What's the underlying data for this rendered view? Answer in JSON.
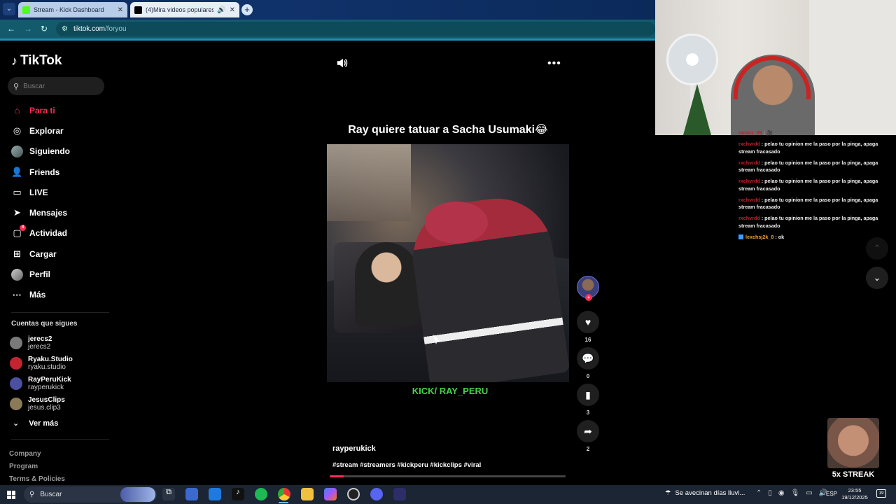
{
  "browser": {
    "tabs": [
      {
        "title": "Stream - Kick Dashboard",
        "favicon_color": "#53fc18",
        "active": false
      },
      {
        "title": "(4)Mira videos populares s",
        "favicon_color": "#000000",
        "active": true
      }
    ],
    "url_host": "tiktok.com",
    "url_path": "/foryou"
  },
  "tiktok": {
    "logo_text": "TikTok",
    "search_placeholder": "Buscar",
    "nav": [
      {
        "label": "Para ti",
        "icon": "home-icon",
        "active": true
      },
      {
        "label": "Explorar",
        "icon": "compass-icon"
      },
      {
        "label": "Siguiendo",
        "icon": "following-avatar-icon"
      },
      {
        "label": "Friends",
        "icon": "friends-icon"
      },
      {
        "label": "LIVE",
        "icon": "live-icon"
      },
      {
        "label": "Mensajes",
        "icon": "messages-icon"
      },
      {
        "label": "Actividad",
        "icon": "activity-icon",
        "badge": "4"
      },
      {
        "label": "Cargar",
        "icon": "upload-icon"
      },
      {
        "label": "Perfil",
        "icon": "profile-avatar-icon"
      },
      {
        "label": "Más",
        "icon": "more-icon"
      }
    ],
    "following_header": "Cuentas que sigues",
    "following": [
      {
        "name": "jerecs2",
        "handle": "jerecs2",
        "color": "#7a7a7a"
      },
      {
        "name": "Ryaku.Studio",
        "handle": "ryaku.studio",
        "color": "#c4242f"
      },
      {
        "name": "RayPeruKick",
        "handle": "rayperukick",
        "color": "#4b50a0"
      },
      {
        "name": "JesusClips",
        "handle": "jesus.clip3",
        "color": "#8a7a55"
      }
    ],
    "see_more": "Ver más",
    "footer_links": [
      "Company",
      "Program",
      "Terms & Policies"
    ],
    "video": {
      "title": "Ray quiere tatuar a Sacha Usumaki😂",
      "overlay_caption": "KICK/ RAY_PERU",
      "likes": "16",
      "comments": "0",
      "saves": "3",
      "shares": "2",
      "author": "rayperukick",
      "hashtags": "#stream #streamers #kickperu #kickclips #viral",
      "progress": 0.06
    }
  },
  "stream_overlay": {
    "chat": [
      {
        "user": "ramirz_09",
        "msg": "🎥",
        "color": "#c0202e"
      },
      {
        "user": "rxchvrdd",
        "msg": "pelao tu opinion me la paso por la pinga, apaga stream fracasado",
        "color": "#c0202e"
      },
      {
        "user": "rxchvrdd",
        "msg": "pelao tu opinion me la paso por la pinga, apaga stream fracasado",
        "color": "#c0202e"
      },
      {
        "user": "rxchvrdd",
        "msg": "pelao tu opinion me la paso por la pinga, apaga stream fracasado",
        "color": "#c0202e"
      },
      {
        "user": "rxchvrdd",
        "msg": "pelao tu opinion me la paso por la pinga, apaga stream fracasado",
        "color": "#c0202e"
      },
      {
        "user": "rxchvrdd",
        "msg": "pelao tu opinion me la paso por la pinga, apaga stream fracasado",
        "color": "#c0202e"
      },
      {
        "user": "lexchsj2k_8",
        "msg": "ok",
        "color": "#e8a640",
        "icon": true
      }
    ],
    "streak_text": "5x STREAK"
  },
  "taskbar": {
    "search_placeholder": "Buscar",
    "weather_text": "Se avecinan días lluvi...",
    "language": "ESP",
    "time": "23:55",
    "date": "19/12/2025",
    "notification_count": "19"
  }
}
